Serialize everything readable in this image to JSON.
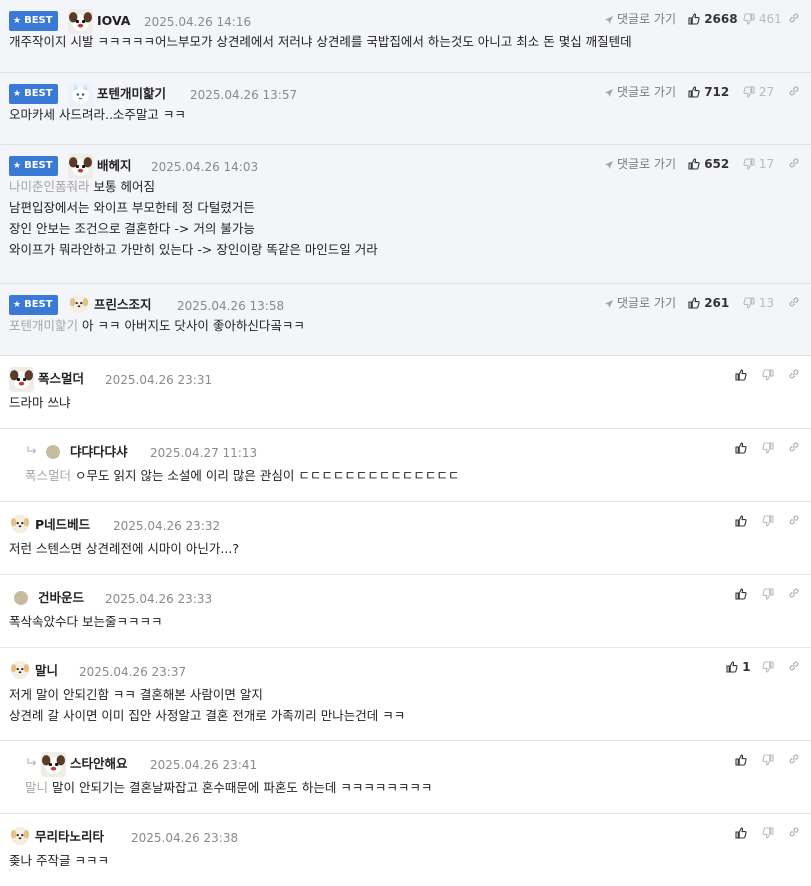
{
  "comments": [
    {
      "type": "best",
      "avatar": "dog",
      "nick": "IOVA",
      "date": "2025.04.26 14:16",
      "goto": "댓글로 가기",
      "up": "2668",
      "down": "461",
      "mention": "",
      "lines": [
        "개주작이지 시발 ㅋㅋㅋㅋㅋ어느부모가 상견례에서 저러냐 상견례를 국밥집에서 하는것도 아니고 최소 돈 몇십 깨질텐데"
      ]
    },
    {
      "type": "best",
      "avatar": "cat",
      "nick": "포텐개미핥기",
      "date": "2025.04.26 13:57",
      "goto": "댓글로 가기",
      "up": "712",
      "down": "27",
      "mention": "",
      "lines": [
        "오마카세 사드려라..소주말고 ㅋㅋ"
      ]
    },
    {
      "type": "best",
      "avatar": "dog",
      "nick": "배헤지",
      "date": "2025.04.26 14:03",
      "goto": "댓글로 가기",
      "up": "652",
      "down": "17",
      "mention": "나미춘인폼줘라",
      "lines": [
        "보통 헤어짐",
        "남편입장에서는 와이프 부모한테 정 다털렸거든",
        "장인 안보는 조건으로 결혼한다 -> 거의 불가능",
        "와이프가 뭐라안하고 가만히 있는다 -> 장인이랑 똑같은 마인드일 거라"
      ]
    },
    {
      "type": "best",
      "avatar": "puppy",
      "nick": "프린스조지",
      "date": "2025.04.26 13:58",
      "goto": "댓글로 가기",
      "up": "261",
      "down": "13",
      "mention": "포텐개미핥기",
      "lines": [
        "아 ㅋㅋ 아버지도 닷사이 좋아하신다곸ㅋㅋ"
      ]
    },
    {
      "type": "normal",
      "avatar": "dog",
      "nick": "폭스멀더",
      "date": "2025.04.26 23:31",
      "up": "",
      "down": "",
      "mention": "",
      "lines": [
        "드라마 쓰냐"
      ]
    },
    {
      "type": "reply",
      "avatar": "dot",
      "nick": "댜댜다댜샤",
      "date": "2025.04.27 11:13",
      "up": "",
      "down": "",
      "mention": "폭스멀더",
      "lines": [
        "ㅇ무도 읽지 않는 소설에 이리 많은 관심이 ㄷㄷㄷㄷㄷㄷㄷㄷㄷㄷㄷㄷㄷㄷ"
      ]
    },
    {
      "type": "normal",
      "avatar": "puppy",
      "nick": "P네드베드",
      "date": "2025.04.26 23:32",
      "up": "",
      "down": "",
      "mention": "",
      "lines": [
        "저런 스텐스면 상견례전에 시마이 아닌가...?"
      ]
    },
    {
      "type": "normal",
      "avatar": "dot",
      "nick": "건바운드",
      "date": "2025.04.26 23:33",
      "up": "",
      "down": "",
      "mention": "",
      "lines": [
        "폭삭속았수다 보는줄ㅋㅋㅋㅋ"
      ]
    },
    {
      "type": "normal",
      "avatar": "puppy",
      "nick": "말니",
      "date": "2025.04.26 23:37",
      "up": "1",
      "down": "",
      "mention": "",
      "lines": [
        "저게 말이 안되긴함 ㅋㅋ 결혼해본 사람이면 알지",
        "상견례 갈 사이면 이미 집안 사정알고 결혼 전개로 가족끼리 만나는건데 ㅋㅋ"
      ]
    },
    {
      "type": "reply",
      "avatar": "dog",
      "nick": "스타안해요",
      "date": "2025.04.26 23:41",
      "up": "",
      "down": "",
      "mention": "말니",
      "lines": [
        "말이 안되기는 결혼날짜잡고 혼수때문에 파혼도 하는데 ㅋㅋㅋㅋㅋㅋㅋㅋ"
      ]
    },
    {
      "type": "normal",
      "avatar": "puppy",
      "nick": "무리타노리타",
      "date": "2025.04.26 23:38",
      "up": "",
      "down": "",
      "mention": "",
      "lines": [
        "좆나 주작글 ㅋㅋㅋ"
      ]
    }
  ],
  "labels": {
    "best": "BEST"
  },
  "icons": {
    "star": "star-icon",
    "thumb_up": "thumb-up-icon",
    "thumb_down": "thumb-down-icon",
    "link": "link-icon",
    "send": "send-arrow-icon",
    "reply": "reply-arrow-icon"
  },
  "colors": {
    "badge": "#3a7ad6",
    "best_bg": "#f3f5f8",
    "mention": "#a6a6a6",
    "date": "#8a8a8a"
  }
}
